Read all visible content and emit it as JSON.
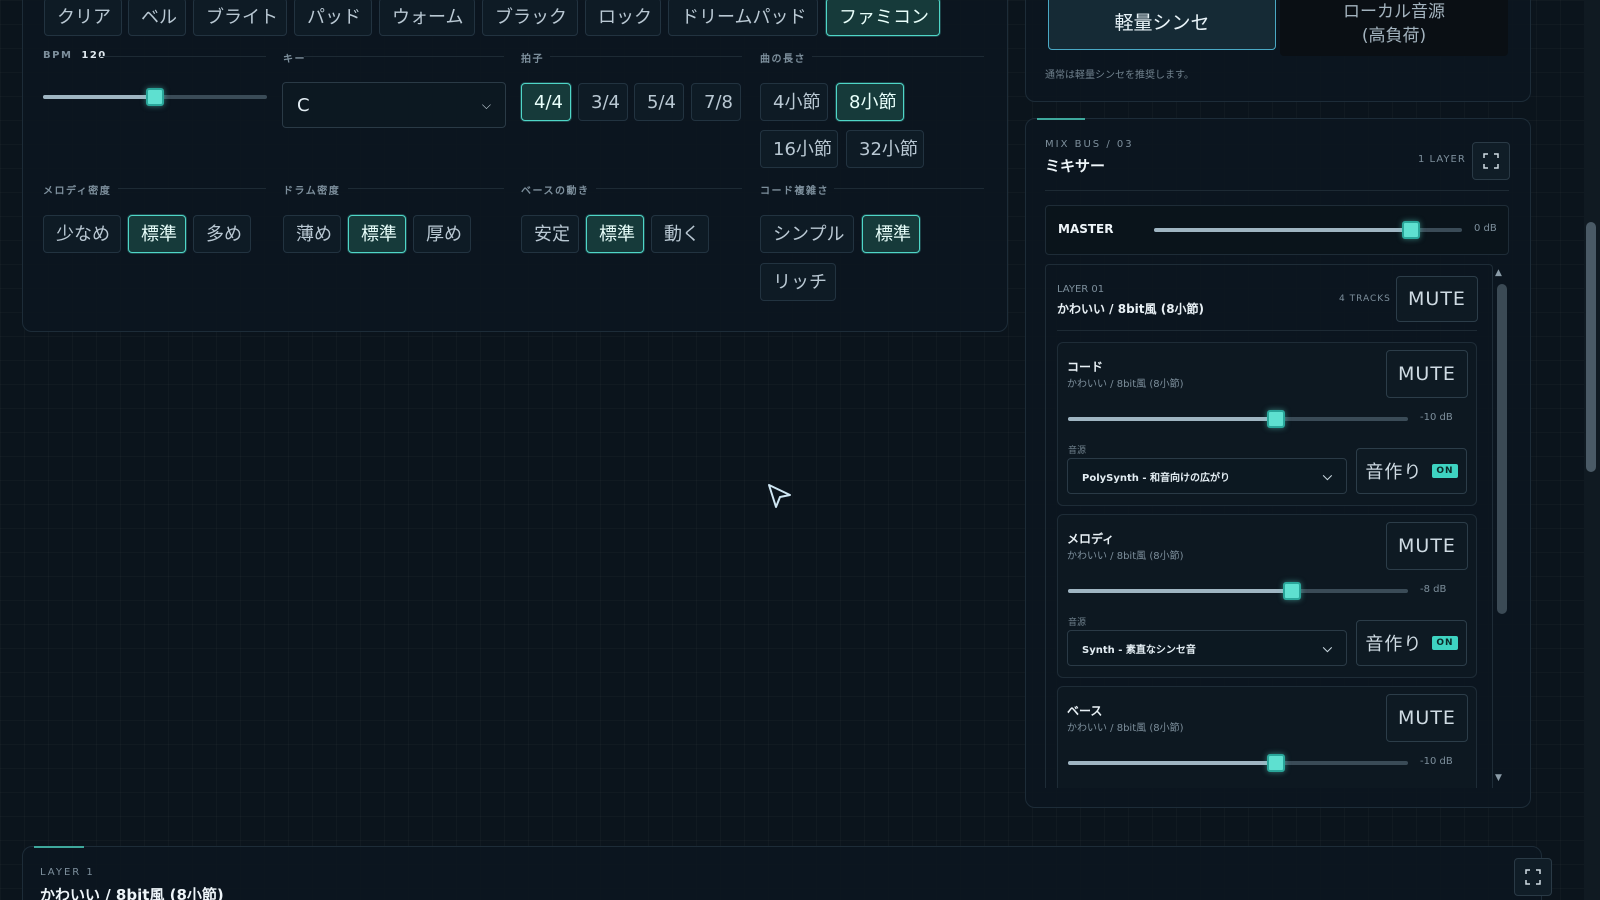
{
  "tones": [
    "クリア",
    "ベル",
    "ブライト",
    "パッド",
    "ウォーム",
    "ブラック",
    "ロック",
    "ドリームパッド",
    "ファミコン"
  ],
  "tone_active": "ファミコン",
  "bpm": {
    "label": "BPM",
    "value": "120",
    "fraction": 0.5
  },
  "key": {
    "label": "キー",
    "value": "C"
  },
  "meter": {
    "label": "拍子",
    "options": [
      "4/4",
      "3/4",
      "5/4",
      "7/8"
    ],
    "active": "4/4"
  },
  "length": {
    "label": "曲の長さ",
    "options": [
      "4小節",
      "8小節",
      "16小節",
      "32小節"
    ],
    "active": "8小節"
  },
  "melody_density": {
    "label": "メロディ密度",
    "options": [
      "少なめ",
      "標準",
      "多め"
    ],
    "active": "標準"
  },
  "drum_density": {
    "label": "ドラム密度",
    "options": [
      "薄め",
      "標準",
      "厚め"
    ],
    "active": "標準"
  },
  "bass_motion": {
    "label": "ベースの動き",
    "options": [
      "安定",
      "標準",
      "動く"
    ],
    "active": "標準"
  },
  "chord_complexity": {
    "label": "コード複雑さ",
    "options": [
      "シンプル",
      "標準",
      "リッチ"
    ],
    "active": "標準"
  },
  "synth_mode": {
    "light": "軽量シンセ",
    "local_line1": "ローカル音源",
    "local_line2": "(高負荷)",
    "hint": "通常は軽量シンセを推奨します。"
  },
  "mixer": {
    "bus_label": "MIX BUS / 03",
    "title": "ミキサー",
    "layer_count": "1 LAYER",
    "master": {
      "label": "MASTER",
      "db": "0 dB",
      "fraction": 0.83
    },
    "layer": {
      "label": "LAYER 01",
      "name": "かわいい / 8bit風 (8小節)",
      "tracks": "4 TRACKS",
      "mute": "MUTE"
    },
    "tracks": [
      {
        "name": "コード",
        "sub": "かわいい / 8bit風 (8小節)",
        "db": "-10 dB",
        "fraction": 0.61,
        "mute": "MUTE",
        "source_label": "音源",
        "source": "PolySynth - 和音向けの広がり",
        "tone_btn": "音作り",
        "on": "ON"
      },
      {
        "name": "メロディ",
        "sub": "かわいい / 8bit風 (8小節)",
        "db": "-8 dB",
        "fraction": 0.66,
        "mute": "MUTE",
        "source_label": "音源",
        "source": "Synth - 素直なシンセ音",
        "tone_btn": "音作り",
        "on": "ON"
      },
      {
        "name": "ベース",
        "sub": "かわいい / 8bit風 (8小節)",
        "db": "-10 dB",
        "fraction": 0.61,
        "mute": "MUTE"
      }
    ]
  },
  "bottom": {
    "layer_label": "LAYER 1",
    "title": "かわいい / 8bit風 (8小節)"
  },
  "colors": {
    "accent": "#4fd6c7",
    "background": "#0b141c"
  }
}
